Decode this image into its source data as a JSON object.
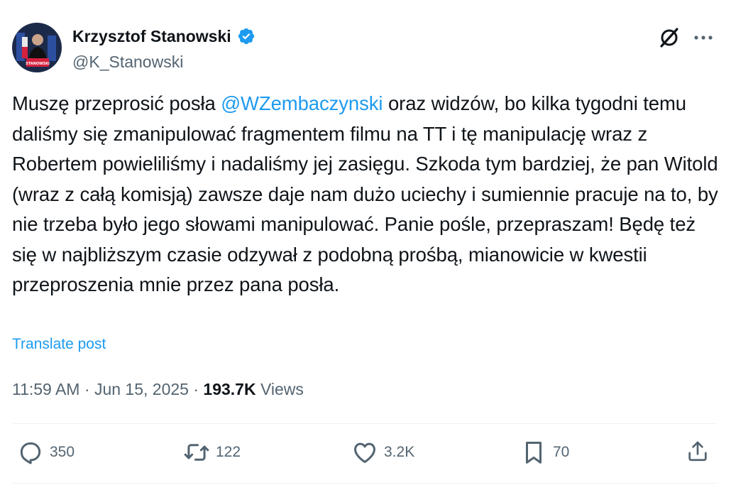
{
  "author": {
    "display_name": "Krzysztof Stanowski",
    "handle": "@K_Stanowski",
    "verified": true,
    "avatar_label": "STANOWSKI"
  },
  "post": {
    "text_before_mention": "Muszę przeprosić posła ",
    "mention": "@WZembaczynski",
    "text_after_mention": " oraz widzów, bo kilka tygodni temu daliśmy się zmanipulować fragmentem filmu na TT i tę manipulację wraz z Robertem powieliliśmy i nadaliśmy jej zasięgu. Szkoda tym bardziej, że pan Witold (wraz z całą komisją) zawsze daje nam dużo uciechy i sumiennie pracuje na to, by nie trzeba było jego słowami manipulować. Panie pośle, przepraszam! Będę też się w najbliższym czasie odzywał z podobną prośbą, mianowicie w kwestii przeproszenia mnie przez pana posła.",
    "translate_label": "Translate post"
  },
  "meta": {
    "time": "11:59 AM",
    "separator": " · ",
    "date": "Jun 15, 2025",
    "views_count": "193.7K",
    "views_label": " Views"
  },
  "actions": {
    "replies": "350",
    "reposts": "122",
    "likes": "3.2K",
    "bookmarks": "70"
  },
  "colors": {
    "accent": "#1d9bf0",
    "text_primary": "#0f1419",
    "text_secondary": "#536471",
    "divider": "#eff3f4"
  },
  "icons": [
    "grok-icon",
    "more-icon",
    "verified-badge-icon",
    "reply-icon",
    "repost-icon",
    "like-icon",
    "bookmark-icon",
    "share-icon"
  ]
}
